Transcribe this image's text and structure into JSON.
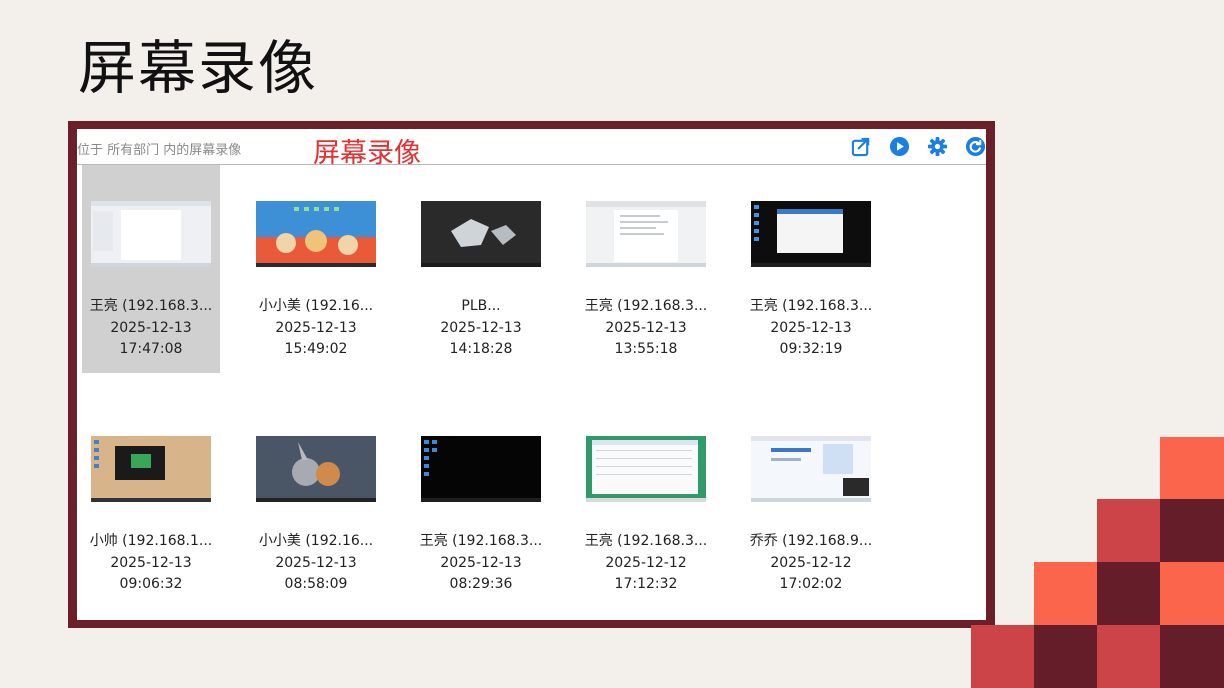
{
  "slide": {
    "title": "屏幕录像"
  },
  "app": {
    "breadcrumb": "位于 所有部门 内的屏幕录像",
    "overlay_label": "屏幕录像",
    "toolbar_icons": [
      "export-icon",
      "play-icon",
      "settings-gear-icon",
      "refresh-icon"
    ],
    "accent_color": "#1a7fe0"
  },
  "recordings": [
    {
      "name": "王亮 (192.168.3...",
      "date": "2025-12-13",
      "time": "17:47:08",
      "selected": true
    },
    {
      "name": "小小美 (192.16...",
      "date": "2025-12-13",
      "time": "15:49:02",
      "selected": false
    },
    {
      "name": "PLB...",
      "date": "2025-12-13",
      "time": "14:18:28",
      "selected": false
    },
    {
      "name": "王亮 (192.168.3...",
      "date": "2025-12-13",
      "time": "13:55:18",
      "selected": false
    },
    {
      "name": "王亮 (192.168.3...",
      "date": "2025-12-13",
      "time": "09:32:19",
      "selected": false
    },
    {
      "name": "小帅 (192.168.1...",
      "date": "2025-12-13",
      "time": "09:06:32",
      "selected": false
    },
    {
      "name": "小小美 (192.16...",
      "date": "2025-12-13",
      "time": "08:58:09",
      "selected": false
    },
    {
      "name": "王亮 (192.168.3...",
      "date": "2025-12-13",
      "time": "08:29:36",
      "selected": false
    },
    {
      "name": "王亮 (192.168.3...",
      "date": "2025-12-12",
      "time": "17:12:32",
      "selected": false
    },
    {
      "name": "乔乔 (192.168.9...",
      "date": "2025-12-12",
      "time": "17:02:02",
      "selected": false
    }
  ],
  "theme": {
    "frame_color": "#6b1f29",
    "deco_colors": [
      "#fb654b",
      "#cd4448",
      "#651e29"
    ]
  }
}
